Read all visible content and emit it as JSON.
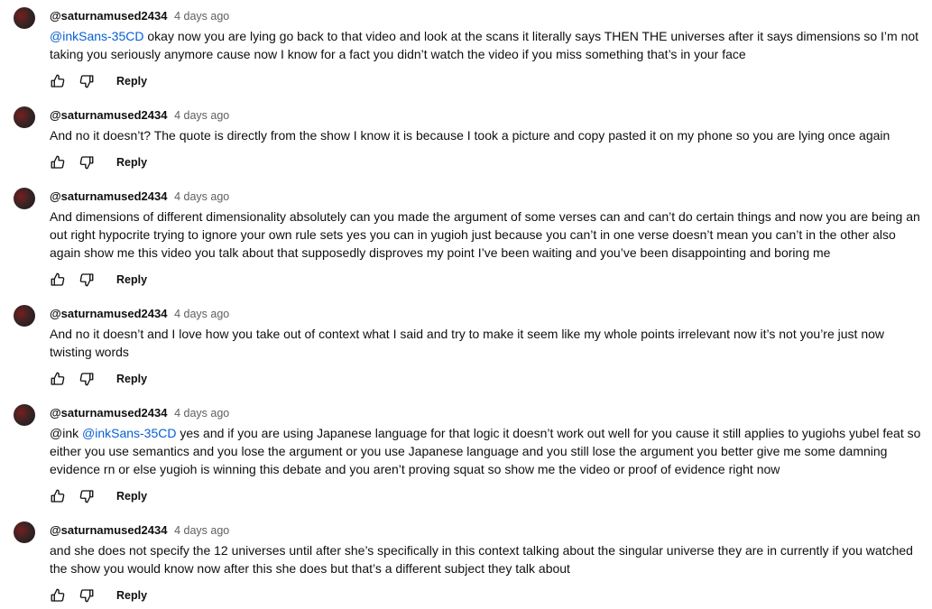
{
  "comments": [
    {
      "author": "@saturnamused2434",
      "time": "4 days ago",
      "mentions": [
        "@inkSans-35CD"
      ],
      "text_before": "",
      "text": " okay now you are lying go back to that video and look at the scans it literally says THEN THE universes after it says dimensions so I’m not taking you seriously anymore cause now I know for a fact you didn’t watch the video if you miss something that’s in your face",
      "reply_label": "Reply"
    },
    {
      "author": "@saturnamused2434",
      "time": "4 days ago",
      "mentions": [],
      "text_before": "",
      "text": "And no it doesn’t? The quote is directly from the show I know it is because I took a picture and copy pasted it on my phone so you are lying once again",
      "reply_label": "Reply"
    },
    {
      "author": "@saturnamused2434",
      "time": "4 days ago",
      "mentions": [],
      "text_before": "",
      "text": "And dimensions of different dimensionality absolutely can you made the argument of some verses can and can’t do certain things and now you are being an out right hypocrite trying to ignore your own rule sets yes you can in yugioh just because you can’t in one verse doesn’t mean you can’t in the other also again show me this video you talk about that supposedly disproves my point I’ve been waiting and you’ve been disappointing and boring me",
      "reply_label": "Reply"
    },
    {
      "author": "@saturnamused2434",
      "time": "4 days ago",
      "mentions": [],
      "text_before": "",
      "text": "And no it doesn’t and I love how you take out of context what I said and try to make it seem like my whole points irrelevant now it’s not you’re just now twisting words",
      "reply_label": "Reply"
    },
    {
      "author": "@saturnamused2434",
      "time": "4 days ago",
      "mentions": [
        "@inkSans-35CD"
      ],
      "text_before": "@ink ",
      "text": " yes and if you are using Japanese language for that logic it doesn’t work out well for you cause it still applies to yugiohs yubel feat so either you use semantics and you lose the argument or you use Japanese language and you still lose the argument you better give me some damning evidence rn or else yugioh is winning this debate and you aren’t proving squat so show me the video or proof of evidence right now",
      "reply_label": "Reply"
    },
    {
      "author": "@saturnamused2434",
      "time": "4 days ago",
      "mentions": [],
      "text_before": "",
      "text": "and she does not specify the 12 universes until after she’s specifically in this context talking about the singular universe they are in currently if you watched the show you would know now after this she does but that’s a different subject they talk about",
      "reply_label": "Reply"
    }
  ],
  "icons": {
    "like": "thumbs-up-icon",
    "dislike": "thumbs-down-icon"
  },
  "colors": {
    "mention": "#065fd4",
    "meta": "#606060",
    "text": "#0f0f0f"
  }
}
